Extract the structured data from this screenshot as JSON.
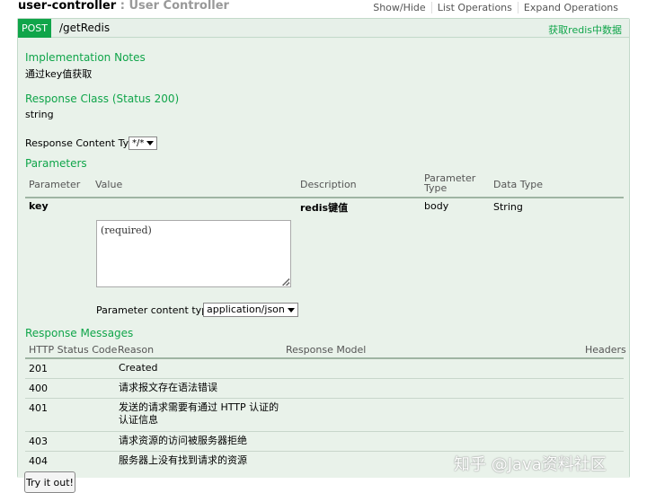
{
  "controller": {
    "name": "user-controller",
    "separator": ":",
    "display_name": "User Controller",
    "links": [
      "Show/Hide",
      "List Operations",
      "Expand Operations"
    ]
  },
  "operation": {
    "method": "POST",
    "path": "/getRedis",
    "summary": "获取redis中数据",
    "implementation_notes_title": "Implementation Notes",
    "implementation_notes": "通过key值获取",
    "response_class_title": "Response Class (Status 200)",
    "response_class": "string",
    "response_content_type_label": "Response Content Type",
    "response_content_type_value": "*/*",
    "parameters_title": "Parameters",
    "parameter_headers": {
      "parameter": "Parameter",
      "value": "Value",
      "description": "Description",
      "parameter_type_line1": "Parameter",
      "parameter_type_line2": "Type",
      "data_type": "Data Type"
    },
    "parameter": {
      "key": "key",
      "value_placeholder": "(required)",
      "description": "redis键值",
      "param_type": "body",
      "data_type": "String",
      "content_type_label": "Parameter content type:",
      "content_type_value": "application/json"
    },
    "response_messages_title": "Response Messages",
    "response_headers": {
      "status_code": "HTTP Status Code",
      "reason": "Reason",
      "model": "Response Model",
      "headers": "Headers"
    },
    "responses": [
      {
        "code": "201",
        "reason_line1": "Created",
        "reason_line2": ""
      },
      {
        "code": "400",
        "reason_line1": "请求报文存在语法错误",
        "reason_line2": ""
      },
      {
        "code": "401",
        "reason_line1": "发送的请求需要有通过 HTTP 认证的",
        "reason_line2": "认证信息"
      },
      {
        "code": "403",
        "reason_line1": "请求资源的访问被服务器拒绝",
        "reason_line2": ""
      },
      {
        "code": "404",
        "reason_line1": "服务器上没有找到请求的资源",
        "reason_line2": ""
      }
    ],
    "try_button": "Try it out!"
  },
  "watermark": "知乎 @Java资料社区",
  "colors": {
    "accent": "#10a54a",
    "panel_bg": "#e9f2ea",
    "panel_border": "#c3d9c9"
  }
}
